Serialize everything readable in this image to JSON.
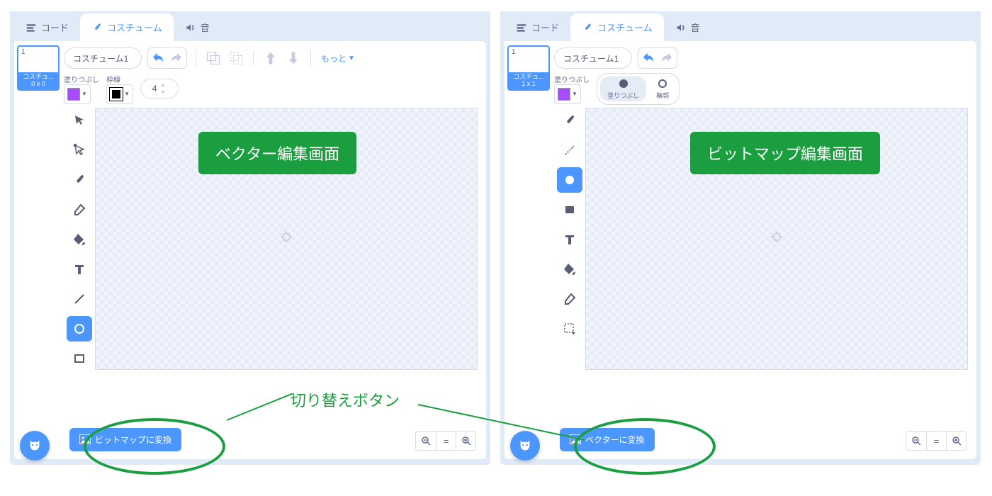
{
  "tabs": {
    "code": "コード",
    "costume": "コスチューム",
    "sound": "音"
  },
  "left": {
    "thumb": {
      "num": "1",
      "name": "コスチュ...",
      "size": "0 x 0"
    },
    "costume_name": "コスチューム1",
    "more": "もっと",
    "fill_label": "塗りつぶし",
    "outline_label": "枠線",
    "outline_width": "4",
    "tools": [
      "select",
      "reshape",
      "brush",
      "eraser",
      "fill",
      "text",
      "line",
      "circle",
      "rect"
    ],
    "convert": "ビットマップに変換",
    "badge": "ベクター編集画面"
  },
  "right": {
    "thumb": {
      "num": "1",
      "name": "コスチュ...",
      "size": "1 x 1"
    },
    "costume_name": "コスチューム1",
    "fill_label": "塗りつぶし",
    "mode_fill": "塗りつぶし",
    "mode_outline": "輪郭",
    "tools": [
      "brush",
      "line",
      "circle",
      "rect",
      "text",
      "fill",
      "eraser",
      "select-rect"
    ],
    "convert": "ベクターに変換",
    "badge": "ビットマップ編集画面"
  },
  "callout": "切り替えボタン",
  "fill_color": "#a64dff",
  "outline_color": "#000000"
}
